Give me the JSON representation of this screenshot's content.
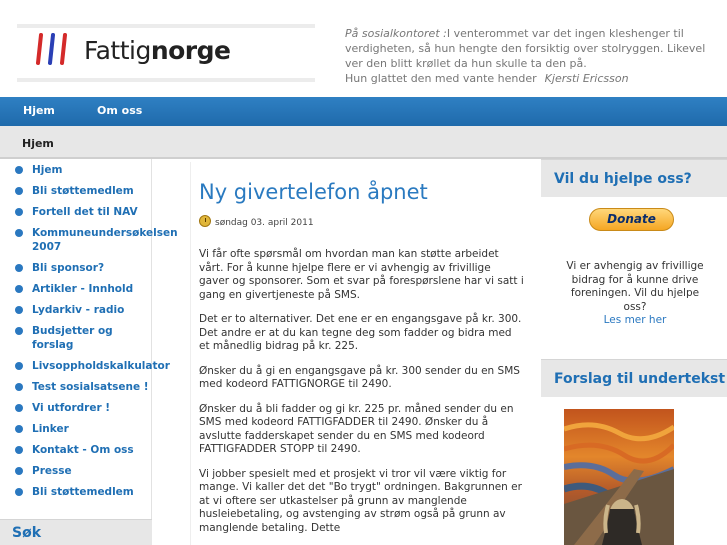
{
  "site": {
    "logo_text_light": "Fattig",
    "logo_text_bold": "norge",
    "quote_intro": "På sosialkontoret :",
    "quote_text": "I venterommet var det ingen kleshenger til verdigheten, så hun hengte den forsiktig over stolryggen. Likevel ver den blitt krøllet da hun skulle ta den på.",
    "quote_line2": "Hun glattet den med vante hender",
    "quote_author": "Kjersti Ericsson"
  },
  "nav": {
    "home": "Hjem",
    "about": "Om oss"
  },
  "breadcrumb": "Hjem",
  "sidebar": {
    "items": [
      "Hjem",
      "Bli støttemedlem",
      "Fortell det til NAV",
      "Kommuneundersøkelsen 2007",
      "Bli sponsor?",
      "Artikler - Innhold",
      "Lydarkiv - radio",
      "Budsjetter og forslag",
      "Livsoppholdskalkulator",
      "Test sosialsatsene !",
      "Vi utfordrer !",
      "Linker",
      "Kontakt - Om oss",
      "Presse",
      "Bli støttemedlem"
    ],
    "search_heading": "Søk"
  },
  "post": {
    "title": "Ny givertelefon åpnet",
    "date": "søndag 03. april 2011",
    "paragraphs": [
      "Vi får ofte spørsmål om hvordan man kan støtte arbeidet vårt. For å kunne hjelpe flere er vi avhengig av frivillige gaver og sponsorer. Som et svar på forespørslene har vi satt i gang en givertjeneste på SMS.",
      "Det er to alternativer. Det ene er en engangsgave på kr. 300. Det andre er at du kan tegne deg som fadder og bidra med et månedlig bidrag på kr. 225.",
      "Ønsker du å gi en engangsgave på kr. 300 sender du en SMS med kodeord FATTIGNORGE til 2490.",
      "Ønsker du å bli fadder og gi kr. 225 pr. måned sender du en SMS med kodeord FATTIGFADDER til 2490. Ønsker du å avslutte fadderskapet sender du en SMS med kodeord FATTIGFADDER STOPP til 2490.",
      "Vi jobber spesielt med et prosjekt vi tror vil være viktig for mange. Vi kaller det det \"Bo trygt\" ordningen. Bakgrunnen er at vi oftere ser utkastelser på grunn av manglende husleiebetaling, og avstenging av strøm også på grunn av manglende betaling. Dette"
    ]
  },
  "right": {
    "help_heading": "Vil du hjelpe oss?",
    "donate_label": "Donate",
    "help_text": "Vi er avhengig av frivillige bidrag for å kunne drive foreningen. Vil du hjelpe oss?",
    "more_label": "Les mer her",
    "suggest_heading": "Forslag til undertekst"
  },
  "colors": {
    "nav_blue": "#2a78c0",
    "link_blue": "#1f6fb4",
    "donate_gold": "#f5a623"
  }
}
